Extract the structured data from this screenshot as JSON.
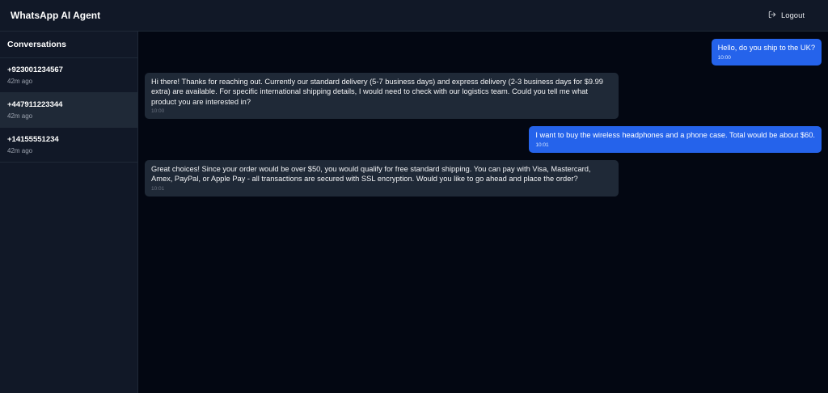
{
  "header": {
    "title": "WhatsApp AI Agent",
    "logout_label": "Logout",
    "logout_icon": "logout-icon"
  },
  "sidebar": {
    "title": "Conversations",
    "conversations": [
      {
        "phone": "+923001234567",
        "time": "42m ago",
        "active": false
      },
      {
        "phone": "+447911223344",
        "time": "42m ago",
        "active": true
      },
      {
        "phone": "+14155551234",
        "time": "42m ago",
        "active": false
      }
    ]
  },
  "chat": {
    "messages": [
      {
        "sender": "user",
        "text": "Hello, do you ship to the UK?",
        "time": "10:00"
      },
      {
        "sender": "bot",
        "text": "Hi there! Thanks for reaching out. Currently our standard delivery (5-7 business days) and express delivery (2-3 business days for $9.99 extra) are available. For specific international shipping details, I would need to check with our logistics team. Could you tell me what product you are interested in?",
        "time": "10:00"
      },
      {
        "sender": "user",
        "text": "I want to buy the wireless headphones and a phone case. Total would be about $60.",
        "time": "10:01"
      },
      {
        "sender": "bot",
        "text": "Great choices! Since your order would be over $50, you would qualify for free standard shipping. You can pay with Visa, Mastercard, Amex, PayPal, or Apple Pay - all transactions are secured with SSL encryption. Would you like to go ahead and place the order?",
        "time": "10:01"
      }
    ]
  },
  "colors": {
    "background": "#030712",
    "panel": "#111827",
    "border": "#1f2937",
    "user_bubble": "#2563eb",
    "bot_bubble": "#1f2937"
  }
}
